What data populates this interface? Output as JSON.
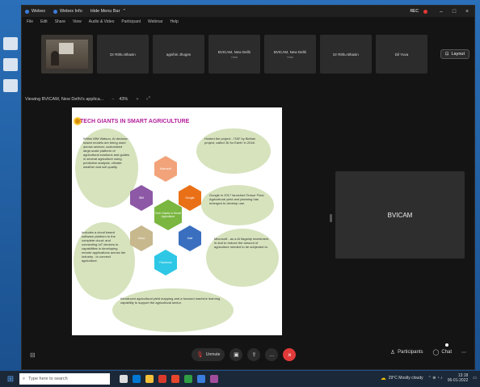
{
  "window": {
    "title_items": [
      "Webex",
      "Webex Info",
      "Hide Menu Bar"
    ],
    "recording_label": "REC",
    "menu": [
      "File",
      "Edit",
      "Share",
      "View",
      "Audio & Video",
      "Participant",
      "Webinar",
      "Help"
    ]
  },
  "participants": [
    {
      "name": "",
      "video": true
    },
    {
      "name": "Dr Rithu Bhasin",
      "sub": ""
    },
    {
      "name": "agnihin Jhoges",
      "sub": ""
    },
    {
      "name": "BVICAM, New Delhi",
      "sub": "Host"
    },
    {
      "name": "BVICAM, New Delhi",
      "sub": "Host"
    },
    {
      "name": "Dr Rithu Bhasin",
      "sub": ""
    },
    {
      "name": "Dil Yuva",
      "sub": ""
    }
  ],
  "layout_button": "Layout",
  "viewing": {
    "label": "Viewing BVICAM, New Delhi's applica...",
    "zoom": "43%"
  },
  "slide": {
    "title": "TECH GIANTS IN SMART AGRICULTURE",
    "blobs": [
      "Within IBM Watson, AI decision based models are being used across sectors; customised large-scale platform of agricultural solutions and guides in several agriculture using predictive analysis, climate weather and soil quality.",
      "Hosted the project - ITAF by Bidhan project, called 'AI for Earth' in 2018.",
      "Google in 2017 launched Tensor Flow; Agricultural yield and planning has emerged to develop use.",
      "Includes a cloud based software platform to the complete cloud; and connecting IoT devices to capabilities in developing remote applications across the industry - to connect agriculture.",
      "Microsoft - as a AI flagship investment in and to reduce the amount of agriculture needed to be subjected to.",
      "Introduced agricultural yield mapping and a focused machine learning capability to support the agricultural sector."
    ],
    "hexes": [
      "IBM",
      "Microsoft",
      "Google",
      "Intel",
      "Cisco",
      "Facebook",
      "Tech Giants in Smart Agriculture"
    ]
  },
  "main_tile": {
    "name": "BVICAM"
  },
  "controls": {
    "mute": "Unmute",
    "participants": "Participants",
    "chat": "Chat"
  },
  "taskbar": {
    "search_placeholder": "Type here to search",
    "weather": "29°C Mostly cloudy",
    "time": "13:18",
    "date": "06-01-2022"
  },
  "colors": {
    "accent": "#3b7ddd",
    "end_call": "#e23a3a",
    "slide_title": "#b21e9b",
    "blob": "#d6e3bd"
  }
}
